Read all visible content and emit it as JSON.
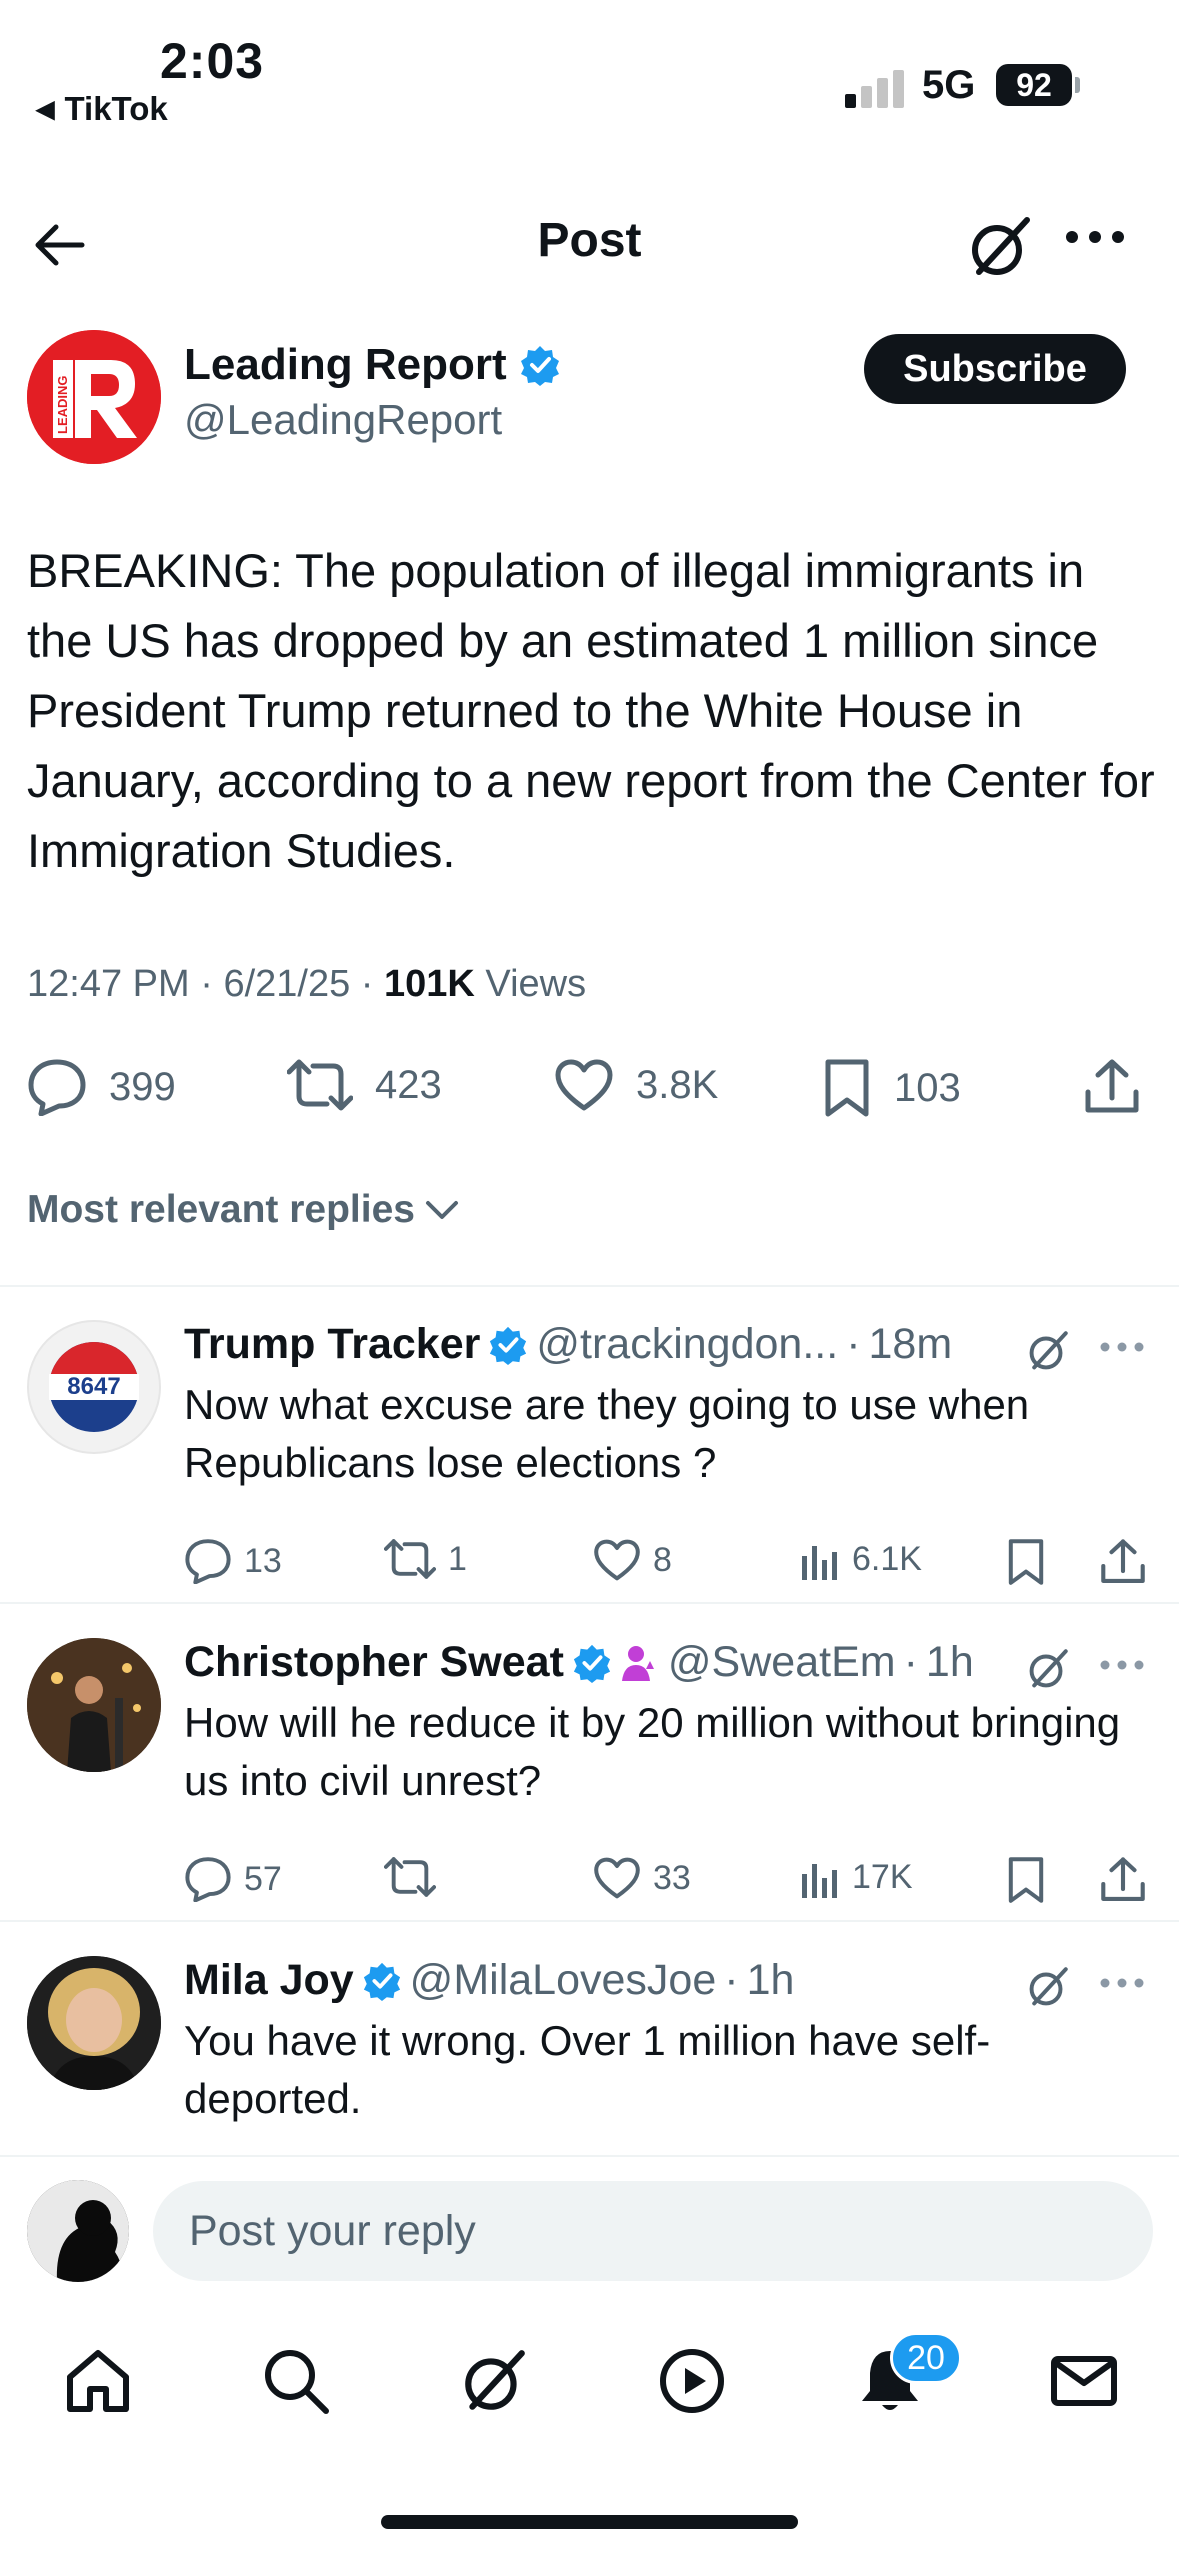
{
  "status_bar": {
    "time": "2:03",
    "back_app": "TikTok",
    "network": "5G",
    "battery": "92"
  },
  "header": {
    "title": "Post"
  },
  "post": {
    "author_name": "Leading Report",
    "author_handle": "@LeadingReport",
    "subscribe_label": "Subscribe",
    "avatar_text": "LEADING",
    "text": "BREAKING: The population of illegal immigrants in the US has dropped by an estimated 1 million since President Trump returned to the White House in January, according to a new report from the Center for Immigration Studies.",
    "time": "12:47 PM",
    "date": "6/21/25",
    "views_count": "101K",
    "views_label": "Views",
    "replies": "399",
    "reposts": "423",
    "likes": "3.8K",
    "bookmarks": "103"
  },
  "replies_filter": "Most relevant replies",
  "replies": [
    {
      "name": "Trump Tracker",
      "handle": "@trackingdon...",
      "time": "18m",
      "avatar_text": "8647",
      "text": "Now what excuse are they going to use when Republicans lose elections ?",
      "replies": "13",
      "reposts": "1",
      "likes": "8",
      "views": "6.1K"
    },
    {
      "name": "Christopher Sweat",
      "handle": "@SweatEm",
      "time": "1h",
      "text": "How will he reduce it by 20 million without bringing us into civil unrest?",
      "replies": "57",
      "reposts": "",
      "likes": "33",
      "views": "17K"
    },
    {
      "name": "Mila Joy",
      "handle": "@MilaLovesJoe",
      "time": "1h",
      "text": "You have it wrong.  Over 1 million have self-deported."
    }
  ],
  "composer": {
    "placeholder": "Post your reply"
  },
  "tab_bar": {
    "notifications_badge": "20"
  },
  "colors": {
    "accent": "#1d9bf0",
    "text": "#0f1419",
    "muted": "#536471",
    "brand_red": "#e31e24"
  }
}
